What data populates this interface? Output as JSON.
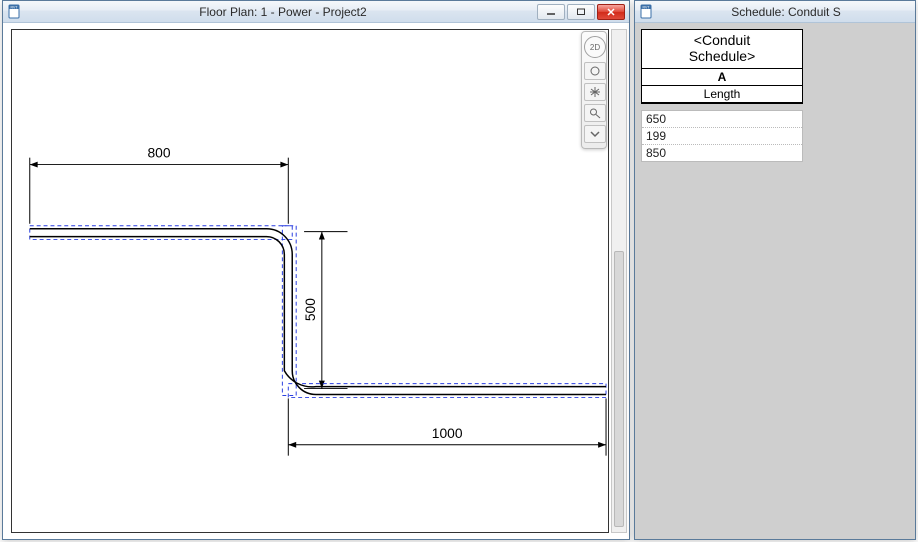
{
  "floorplan": {
    "window_title": "Floor Plan: 1 - Power - Project2",
    "dimensions": {
      "top": "800",
      "middle": "500",
      "bottom": "1000"
    },
    "navbar": {
      "viewcube_label": "2D"
    }
  },
  "schedule": {
    "window_title": "Schedule: Conduit S",
    "table_title_line1": "<Conduit",
    "table_title_line2": "Schedule>",
    "column_letter": "A",
    "column_header": "Length",
    "rows": [
      "650",
      "199",
      "850"
    ]
  },
  "chart_data": {
    "type": "table",
    "title": "<Conduit Schedule>",
    "columns": [
      "Length"
    ],
    "rows": [
      [
        650
      ],
      [
        199
      ],
      [
        850
      ]
    ]
  }
}
